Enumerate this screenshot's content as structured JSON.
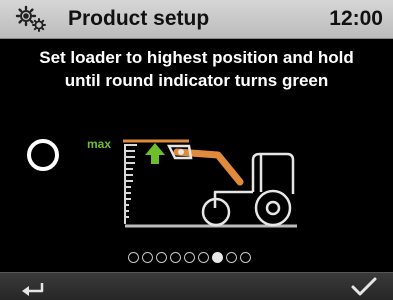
{
  "header": {
    "title": "Product setup",
    "time": "12:00",
    "icon": "settings-gears-icon"
  },
  "instruction": {
    "line1": "Set loader to highest position and hold",
    "line2": "until round indicator turns green"
  },
  "indicator": {
    "state": "not-reached",
    "color_pending": "#ffffff",
    "color_done": "#4caf50"
  },
  "illustration": {
    "max_label": "max",
    "icon": "tractor-loader-icon",
    "arrow": "up-arrow-icon",
    "colors": {
      "max_line": "#e08a3c",
      "arm": "#e08a3c",
      "arrow": "#6cbf2a",
      "tractor": "#e6e6e6"
    }
  },
  "pager": {
    "total": 9,
    "current": 7
  },
  "footer": {
    "back_icon": "back-arrow-icon",
    "confirm_icon": "checkmark-icon"
  }
}
